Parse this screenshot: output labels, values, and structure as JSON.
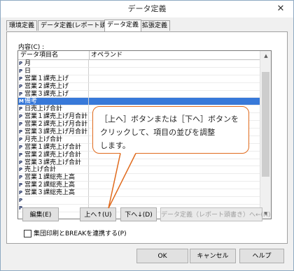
{
  "window": {
    "title": "データ定義",
    "close_symbol": "✕"
  },
  "tabs": [
    {
      "label": "環境定義"
    },
    {
      "label": "データ定義(レポート頭書き)"
    },
    {
      "label": "データ定義"
    },
    {
      "label": "拡張定義"
    }
  ],
  "content_label": "内容(C) :",
  "list": {
    "headers": [
      "データ項目名",
      "オペランド"
    ],
    "rows": [
      {
        "icon": "P",
        "name": "月",
        "selected": false
      },
      {
        "icon": "P",
        "name": "日",
        "selected": false
      },
      {
        "icon": "P",
        "name": "営業１課売上げ",
        "selected": false
      },
      {
        "icon": "P",
        "name": "営業２課売上げ",
        "selected": false
      },
      {
        "icon": "P",
        "name": "営業３課売上げ",
        "selected": false
      },
      {
        "icon": "M",
        "name": "備考",
        "selected": true
      },
      {
        "icon": "P",
        "name": "日売上げ合計",
        "selected": false
      },
      {
        "icon": "P",
        "name": "営業１課売上げ月合計",
        "selected": false
      },
      {
        "icon": "P",
        "name": "営業２課売上げ月合計",
        "selected": false
      },
      {
        "icon": "P",
        "name": "営業３課売上げ月合計",
        "selected": false
      },
      {
        "icon": "P",
        "name": "月売上げ合計",
        "selected": false
      },
      {
        "icon": "P",
        "name": "営業１課売上げ合計",
        "selected": false
      },
      {
        "icon": "P",
        "name": "営業２課売上げ合計",
        "selected": false
      },
      {
        "icon": "P",
        "name": "営業３課売上げ合計",
        "selected": false
      },
      {
        "icon": "P",
        "name": "売上げ合計",
        "selected": false
      },
      {
        "icon": "P",
        "name": "営業１課総売上高",
        "selected": false
      },
      {
        "icon": "P",
        "name": "営業２課総売上高",
        "selected": false
      },
      {
        "icon": "P",
        "name": "営業３課総売上高",
        "selected": false
      },
      {
        "icon": "P",
        "name": "",
        "selected": false
      },
      {
        "icon": "P",
        "name": "",
        "selected": false
      }
    ],
    "scroll_up": "▲",
    "scroll_down": "▼"
  },
  "buttons": {
    "edit": "編集(E)",
    "up": "上へ↑(U)",
    "down": "下へ↓(D)",
    "to_heading": "データ定義（レポート頭書き）へ←(H)"
  },
  "checkbox": {
    "label": "集団印刷とBREAKを連携する(P)",
    "checked": false
  },
  "footer": {
    "ok": "OK",
    "cancel": "キャンセル",
    "help": "ヘルプ"
  },
  "callout": {
    "lines": [
      "［上へ］ボタンまたは［下へ］ボタンを",
      "クリックして、項目の並びを調整",
      "します。"
    ],
    "border_color": "#e06a1c"
  }
}
